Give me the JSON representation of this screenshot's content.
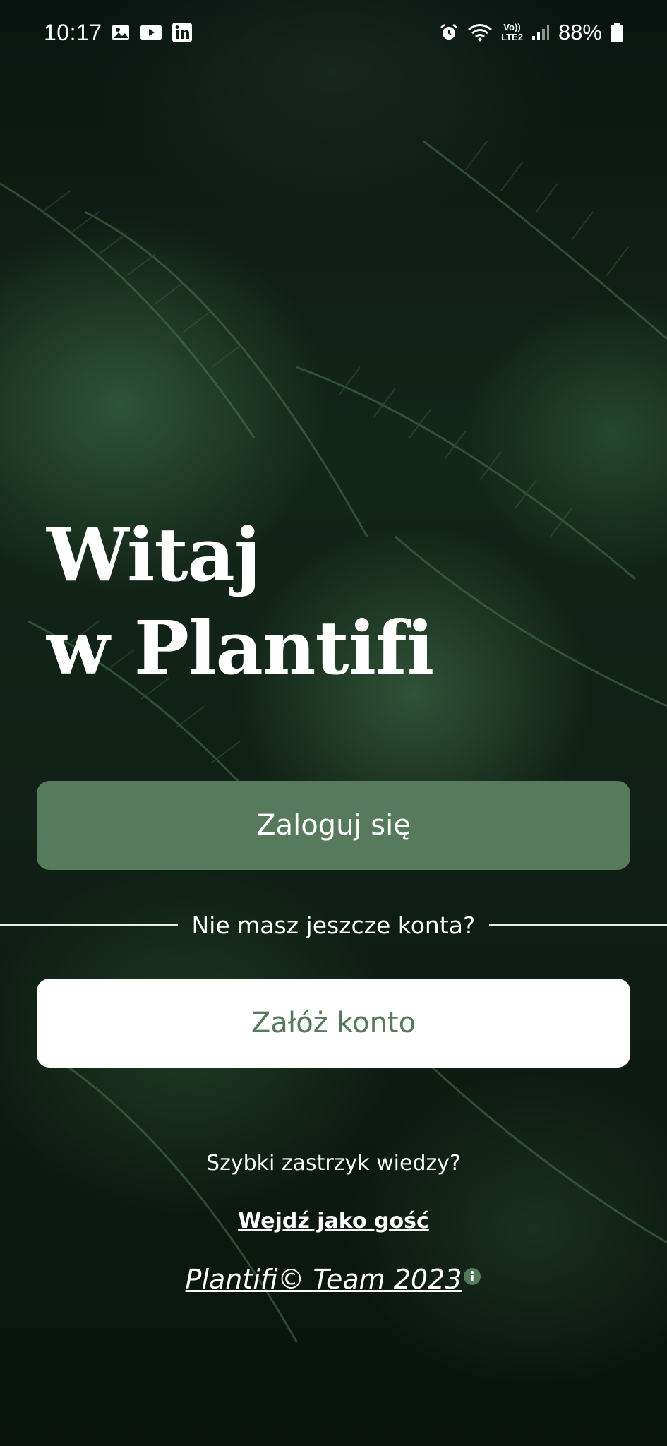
{
  "status_bar": {
    "time": "10:17",
    "left_icons": [
      "image-icon",
      "youtube-icon",
      "linkedin-icon"
    ],
    "right_icons": [
      "alarm-icon",
      "wifi-icon",
      "volte-icon",
      "signal-icon"
    ],
    "network_label_top": "Vo))",
    "network_label_bottom": "LTE2",
    "battery_percent": "88%"
  },
  "welcome": {
    "line1": "Witaj",
    "line2": "w Plantifi"
  },
  "login_button": {
    "label": "Zaloguj się"
  },
  "divider": {
    "text": "Nie masz jeszcze konta?"
  },
  "register_button": {
    "label": "Załóż konto"
  },
  "quick_knowledge": {
    "text": "Szybki zastrzyk wiedzy?"
  },
  "guest_link": {
    "label": "Wejdź jako gość"
  },
  "footer": {
    "text": "Plantifi© Team 2023"
  },
  "colors": {
    "accent": "#577a5c",
    "white": "#ffffff",
    "background": "#0f1f15"
  }
}
